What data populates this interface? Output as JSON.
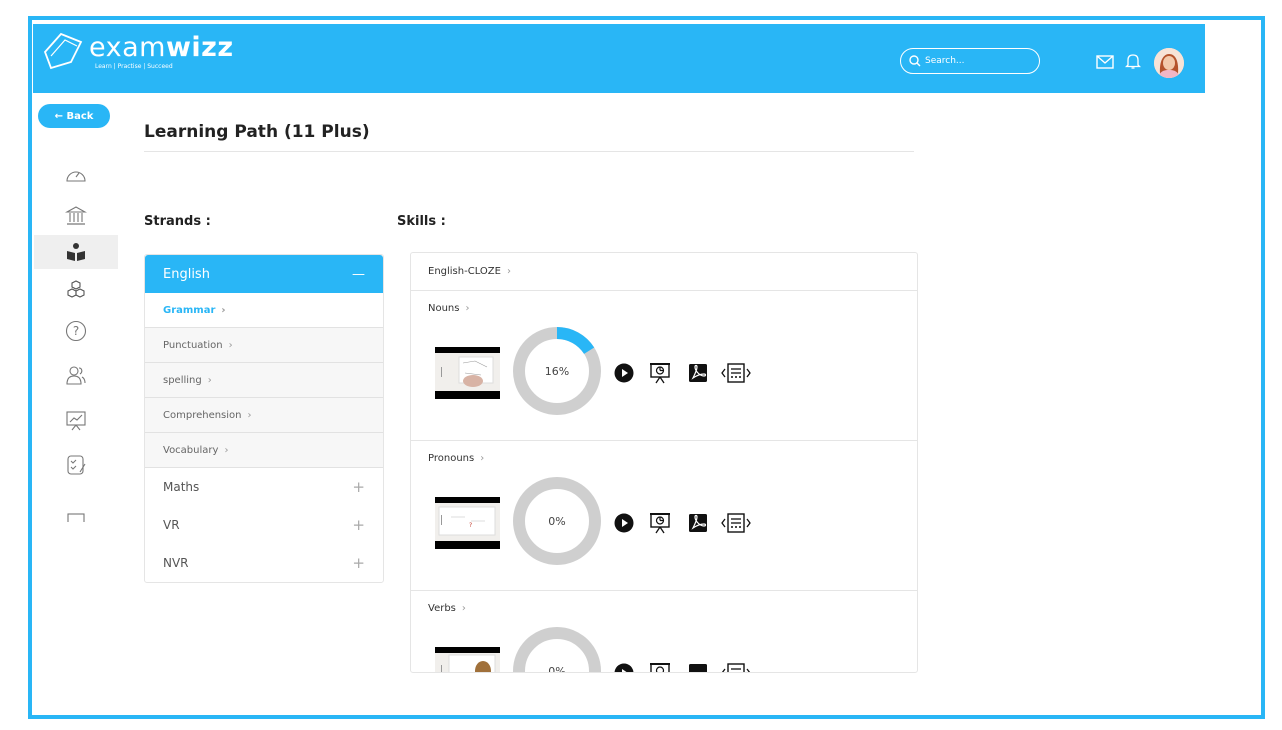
{
  "brand": {
    "name_light": "exam",
    "name_bold": "wizz",
    "tagline": "Learn | Practise | Succeed"
  },
  "header": {
    "search_placeholder": "Search..."
  },
  "nav": {
    "back_label": "← Back"
  },
  "page": {
    "title": "Learning Path (11 Plus)"
  },
  "strands": {
    "label": "Strands :",
    "items": [
      {
        "name": "English",
        "expanded": true,
        "toggle": "—",
        "subitems": [
          {
            "label": "Grammar",
            "arrow": "›"
          },
          {
            "label": "Punctuation",
            "arrow": "›"
          },
          {
            "label": "spelling",
            "arrow": "›"
          },
          {
            "label": "Comprehension",
            "arrow": "›"
          },
          {
            "label": "Vocabulary",
            "arrow": "›"
          }
        ]
      },
      {
        "name": "Maths",
        "toggle": "+"
      },
      {
        "name": "VR",
        "toggle": "+"
      },
      {
        "name": "NVR",
        "toggle": "+"
      }
    ]
  },
  "skills": {
    "label": "Skills :",
    "topic": {
      "label": "English-CLOZE",
      "arrow": "›"
    },
    "items": [
      {
        "name": "Nouns",
        "arrow": "›",
        "progress": 0.16,
        "progress_label": "16%"
      },
      {
        "name": "Pronouns",
        "arrow": "›",
        "progress": 0,
        "progress_label": "0%"
      },
      {
        "name": "Verbs",
        "arrow": "›",
        "progress": 0,
        "progress_label": "0%"
      }
    ]
  },
  "colors": {
    "accent": "#29b6f6",
    "track": "#cfcfcf"
  },
  "icons": {
    "actions": [
      "play-icon",
      "presentation-icon",
      "pdf-icon",
      "worksheet-icon"
    ],
    "sidebar": [
      "speedometer-icon",
      "institution-icon",
      "reader-icon",
      "blocks-icon",
      "help-icon",
      "users-icon",
      "chart-board-icon",
      "quiz-icon",
      "more-icon"
    ]
  }
}
